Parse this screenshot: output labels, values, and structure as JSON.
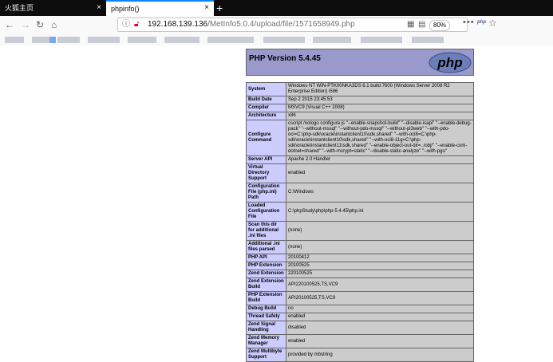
{
  "browser": {
    "tabs": [
      {
        "label": "火狐主页",
        "close": "×"
      },
      {
        "label": "phpinfo()",
        "close": "×"
      }
    ],
    "new_tab": "+",
    "url_host": "192.168.139.136",
    "url_path": "/MetInfo5.0.4/upload/file/1571658949.php",
    "zoom": "80%",
    "more": "•••",
    "php_badge": "php"
  },
  "phpinfo": {
    "title": "PHP Version 5.4.45",
    "logo_text": "php",
    "rows": [
      {
        "label": "System",
        "value": "Windows NT WIN-PTK00NKA3DS 6.1 build 7600 (Windows Server 2008 R2 Enterprise Edition) i586"
      },
      {
        "label": "Build Date",
        "value": "Sep 2 2015 23:45:53"
      },
      {
        "label": "Compiler",
        "value": "MSVC9 (Visual C++ 2008)"
      },
      {
        "label": "Architecture",
        "value": "x86"
      },
      {
        "label": "Configure Command",
        "value": "cscript /nologo configure.js \"--enable-snapshot-build\" \"--disable-isapi\" \"--enable-debug-pack\" \"--without-mssql\" \"--without-pdo-mssql\" \"--without-pi3web\" \"--with-pdo-oci=C:\\php-sdk\\oracle\\instantclient10\\sdk,shared\" \"--with-oci8=C:\\php-sdk\\oracle\\instantclient10\\sdk,shared\" \"--with-oci8-11g=C:\\php-sdk\\oracle\\instantclient11\\sdk,shared\" \"--enable-object-out-dir=../obj/\" \"--enable-com-dotnet=shared\" \"--with-mcrypt=static\" \"--disable-static-analyze\" \"--with-pgo\""
      },
      {
        "label": "Server API",
        "value": "Apache 2.0 Handler"
      },
      {
        "label": "Virtual Directory Support",
        "value": "enabled"
      },
      {
        "label": "Configuration File (php.ini) Path",
        "value": "C:\\Windows"
      },
      {
        "label": "Loaded Configuration File",
        "value": "C:\\phpStudy\\php\\php-5.4.45\\php.ini"
      },
      {
        "label": "Scan this dir for additional .ini files",
        "value": "(none)"
      },
      {
        "label": "Additional .ini files parsed",
        "value": "(none)"
      },
      {
        "label": "PHP API",
        "value": "20100412"
      },
      {
        "label": "PHP Extension",
        "value": "20100525"
      },
      {
        "label": "Zend Extension",
        "value": "220100525"
      },
      {
        "label": "Zend Extension Build",
        "value": "API220100525,TS,VC9"
      },
      {
        "label": "PHP Extension Build",
        "value": "API20100525,TS,VC9"
      },
      {
        "label": "Debug Build",
        "value": "no"
      },
      {
        "label": "Thread Safety",
        "value": "enabled"
      },
      {
        "label": "Zend Signal Handling",
        "value": "disabled"
      },
      {
        "label": "Zend Memory Manager",
        "value": "enabled"
      },
      {
        "label": "Zend Multibyte Support",
        "value": "provided by mbstring"
      }
    ]
  }
}
